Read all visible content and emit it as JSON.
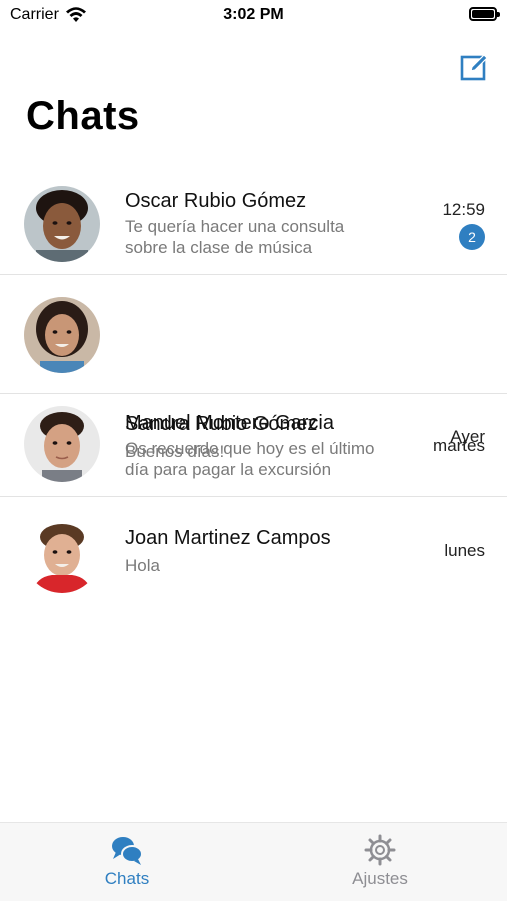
{
  "status": {
    "carrier": "Carrier",
    "time": "3:02 PM"
  },
  "header": {
    "title": "Chats",
    "compose_icon": "compose-icon"
  },
  "chats": [
    {
      "name": "Oscar Rubio Gómez",
      "preview_line1": "Te quería hacer una consulta",
      "preview_line2": "sobre la clase de música",
      "time": "12:59",
      "badge": "2"
    },
    {
      "name": "Sandra Rubio Gómez",
      "preview_line1": "Buenos días!",
      "time": "Ayer"
    },
    {
      "name": "Manuel Montero Garcia",
      "preview_line1": "Os recuerdo que hoy es el último",
      "preview_line2": "día para pagar la excursión",
      "time": "martes"
    },
    {
      "name": "Joan Martinez Campos",
      "preview_line1": "Hola",
      "time": "lunes"
    }
  ],
  "tabs": [
    {
      "label": "Chats",
      "icon": "chat-bubbles-icon",
      "active": true
    },
    {
      "label": "Ajustes",
      "icon": "gear-icon",
      "active": false
    }
  ],
  "colors": {
    "accent": "#2f7fc1",
    "badge": "#2f7fc1",
    "inactive": "#8e8e93",
    "preview_text": "#7a7a7a"
  }
}
